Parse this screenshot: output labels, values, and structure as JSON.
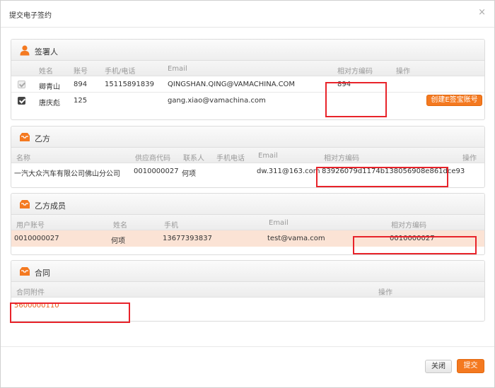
{
  "dialog": {
    "title": "提交电子签约",
    "close_glyph": "×"
  },
  "signers": {
    "title": "签署人",
    "headers": {
      "name": "姓名",
      "account": "账号",
      "phone": "手机/电话",
      "email": "Email",
      "relcode": "相对方编码",
      "action": "操作"
    },
    "rows": [
      {
        "checked": true,
        "name": "卿青山",
        "account": "894",
        "phone": "15115891839",
        "email": "QINGSHAN.QING@VAMACHINA.COM",
        "relcode": "894",
        "action": ""
      },
      {
        "checked": true,
        "name": "唐庆彪",
        "account": "125",
        "phone": "",
        "email": "gang.xiao@vamachina.com",
        "relcode": "",
        "action": "创建E签宝账号"
      }
    ]
  },
  "partyB": {
    "title": "乙方",
    "headers": {
      "name": "名称",
      "supplier_code": "供应商代码",
      "contact": "联系人",
      "phone": "手机电话",
      "email": "Email",
      "relcode": "相对方编码",
      "action": "操作"
    },
    "rows": [
      {
        "name": "一汽大众汽车有限公司佛山分公司",
        "supplier_code": "0010000027",
        "contact": "何项",
        "phone": "",
        "email": "dw.311@163.com",
        "relcode": "83926079d1174b138056908e861dce93",
        "action": ""
      }
    ]
  },
  "partyB_members": {
    "title": "乙方成员",
    "headers": {
      "user_account": "用户账号",
      "name": "姓名",
      "phone": "手机",
      "email": "Email",
      "relcode": "相对方编码"
    },
    "rows": [
      {
        "user_account": "0010000027",
        "name": "何项",
        "phone": "13677393837",
        "email": "test@vama.com",
        "relcode": "0010000027"
      }
    ]
  },
  "contract": {
    "title": "合同",
    "headers": {
      "attachment": "合同附件",
      "action": "操作"
    },
    "rows": [
      {
        "attachment": "5600000110",
        "action": ""
      }
    ]
  },
  "footer": {
    "close_label": "关闭",
    "submit_label": "提交"
  },
  "colors": {
    "accent": "#f47920",
    "annotation": "#e8232a",
    "highlight_row": "#fbe3d5"
  }
}
